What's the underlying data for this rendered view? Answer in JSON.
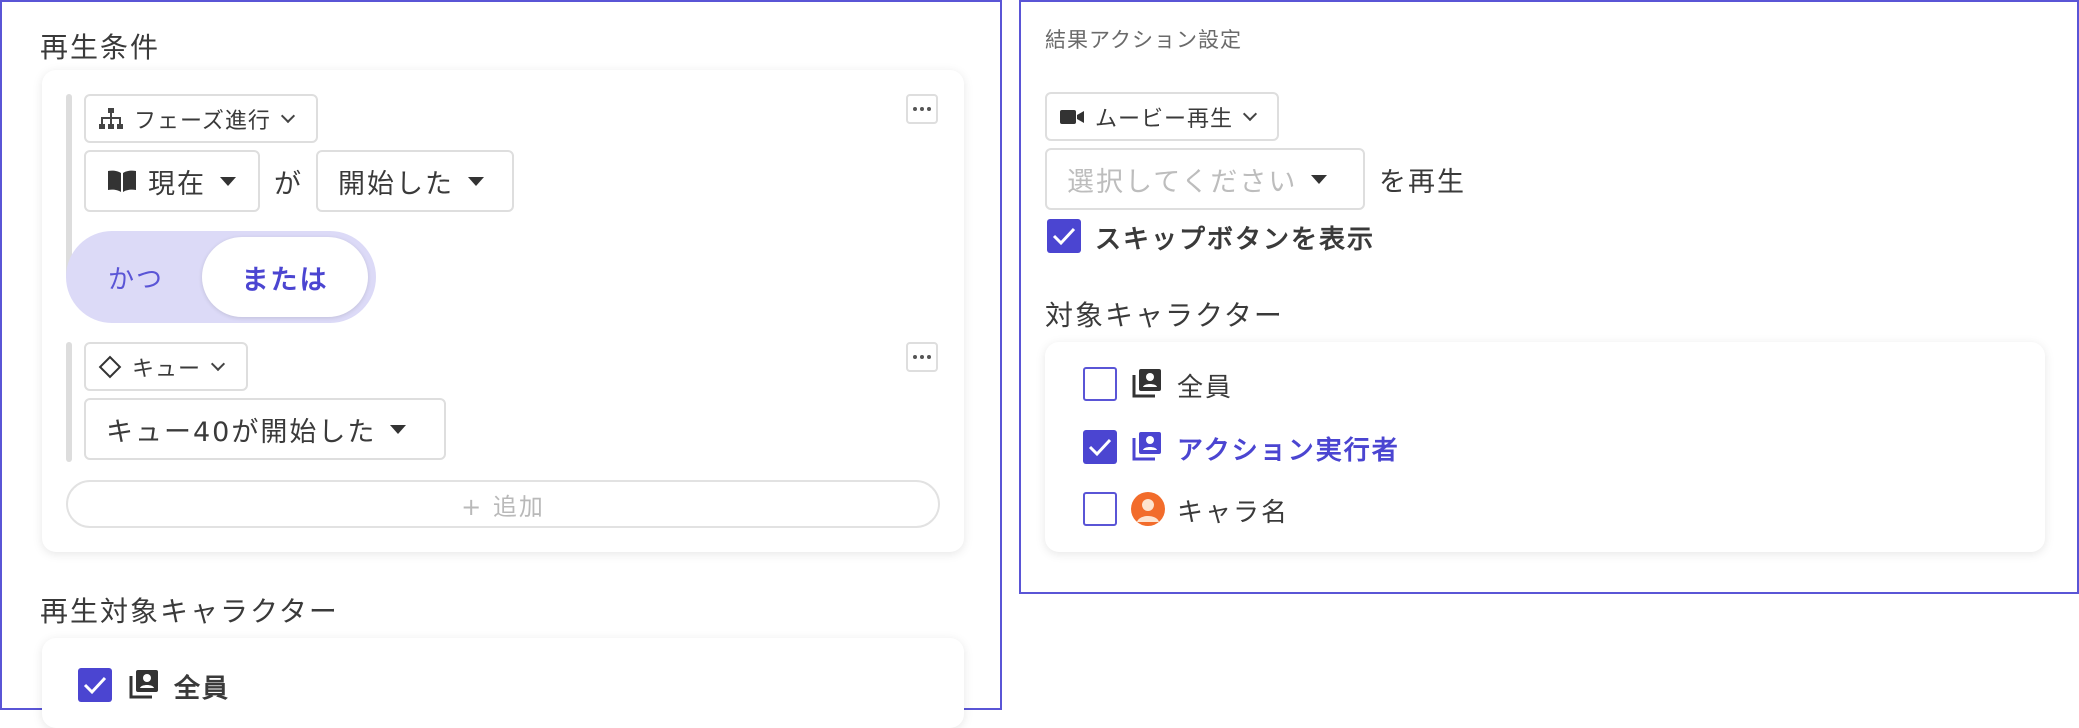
{
  "left": {
    "section_title": "再生条件",
    "condition1": {
      "type_label": "フェーズ進行",
      "subject": "現在",
      "particle": "が",
      "state": "開始した"
    },
    "logic_toggle": {
      "and_label": "かつ",
      "or_label": "または",
      "selected": "または"
    },
    "condition2": {
      "type_label": "キュー",
      "value": "キュー40が開始した"
    },
    "add_label": "+ 追加",
    "target_title": "再生対象キャラクター",
    "target_all_label": "全員"
  },
  "right": {
    "header": "結果アクション設定",
    "action_type": "ムービー再生",
    "movie_placeholder": "選択してください",
    "movie_suffix": "を再生",
    "skip_label": "スキップボタンを表示",
    "target_title": "対象キャラクター",
    "targets": [
      {
        "label": "全員",
        "checked": false,
        "icon": "people-card-icon"
      },
      {
        "label": "アクション実行者",
        "checked": true,
        "icon": "people-card-icon"
      },
      {
        "label": "キャラ名",
        "checked": false,
        "icon": "avatar-icon"
      }
    ]
  },
  "colors": {
    "accent": "#4b45d1",
    "toggle_bg": "#dcdaf7",
    "border": "#5a55d6"
  }
}
